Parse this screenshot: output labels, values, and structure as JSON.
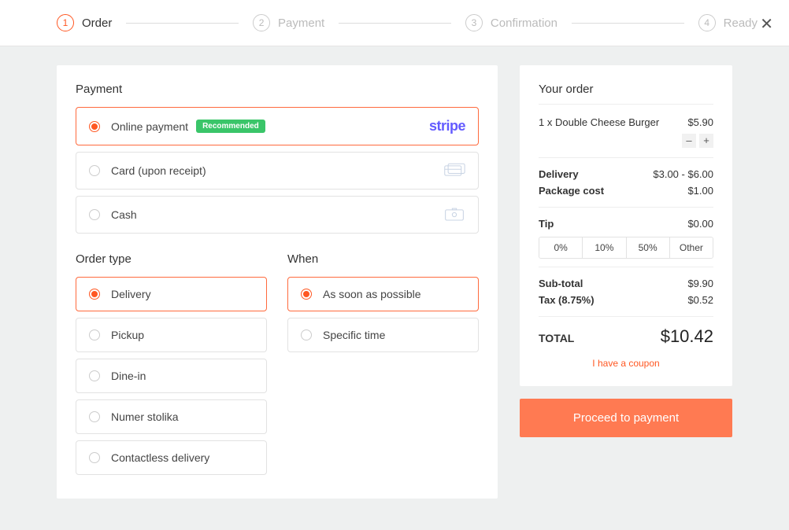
{
  "stepper": {
    "steps": [
      {
        "num": "1",
        "label": "Order"
      },
      {
        "num": "2",
        "label": "Payment"
      },
      {
        "num": "3",
        "label": "Confirmation"
      },
      {
        "num": "4",
        "label": "Ready"
      }
    ]
  },
  "payment": {
    "title": "Payment",
    "options": {
      "online": "Online payment",
      "badge": "Recommended",
      "stripe": "stripe",
      "card": "Card (upon receipt)",
      "cash": "Cash"
    }
  },
  "order_type": {
    "title": "Order type",
    "delivery": "Delivery",
    "pickup": "Pickup",
    "dinein": "Dine-in",
    "table": "Numer stolika",
    "contactless": "Contactless delivery"
  },
  "when": {
    "title": "When",
    "asap": "As soon as possible",
    "specific": "Specific time"
  },
  "summary": {
    "title": "Your order",
    "item_qty": "1 x",
    "item_name": "Double Cheese Burger",
    "item_price": "$5.90",
    "minus": "–",
    "plus": "+",
    "delivery_label": "Delivery",
    "delivery_val": "$3.00 - $6.00",
    "package_label": "Package cost",
    "package_val": "$1.00",
    "tip_label": "Tip",
    "tip_val": "$0.00",
    "tip_0": "0%",
    "tip_10": "10%",
    "tip_50": "50%",
    "tip_other": "Other",
    "subtotal_label": "Sub-total",
    "subtotal_val": "$9.90",
    "tax_label": "Tax (8.75%)",
    "tax_val": "$0.52",
    "total_label": "TOTAL",
    "total_val": "$10.42",
    "coupon": "I have a coupon",
    "proceed": "Proceed to payment"
  }
}
